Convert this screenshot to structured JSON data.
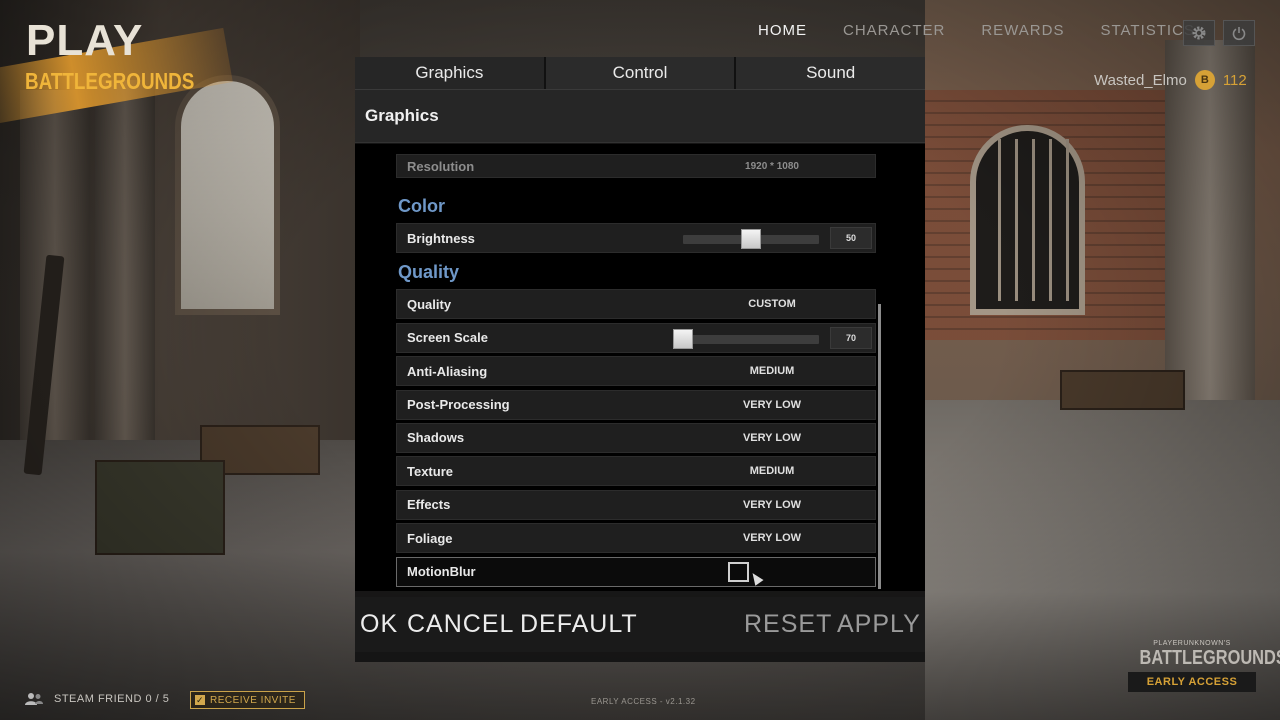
{
  "logo": {
    "play": "PLAY",
    "battlegrounds": "BATTLEGROUNDS"
  },
  "nav": {
    "items": [
      "HOME",
      "CHARACTER",
      "REWARDS",
      "STATISTICS"
    ],
    "active": "HOME"
  },
  "top_icons": {
    "settings": "gear-icon",
    "power": "power-icon"
  },
  "user": {
    "name": "Wasted_Elmo",
    "bp_symbol": "B",
    "bp_value": "112"
  },
  "settings": {
    "tabs": [
      {
        "label": "Graphics"
      },
      {
        "label": "Control"
      },
      {
        "label": "Sound"
      }
    ],
    "active_tab": "Graphics",
    "section_title": "Graphics",
    "resolution": {
      "label": "Resolution",
      "value": "1920 * 1080"
    },
    "color_group": "Color",
    "brightness": {
      "label": "Brightness",
      "value": "50",
      "level": 0.5
    },
    "quality_group": "Quality",
    "quality": {
      "label": "Quality",
      "value": "CUSTOM"
    },
    "screen_scale": {
      "label": "Screen Scale",
      "value": "70",
      "level": 0.0
    },
    "options": [
      {
        "label": "Anti-Aliasing",
        "value": "MEDIUM"
      },
      {
        "label": "Post-Processing",
        "value": "VERY LOW"
      },
      {
        "label": "Shadows",
        "value": "VERY LOW"
      },
      {
        "label": "Texture",
        "value": "MEDIUM"
      },
      {
        "label": "Effects",
        "value": "VERY LOW"
      },
      {
        "label": "Foliage",
        "value": "VERY LOW"
      }
    ],
    "motion_blur": {
      "label": "MotionBlur",
      "checked": false
    },
    "actions_left": {
      "ok": "OK",
      "cancel": "CANCEL",
      "default": "DEFAULT"
    },
    "actions_right": {
      "reset": "RESET",
      "apply": "APPLY"
    }
  },
  "bottom": {
    "friends": "STEAM FRIEND 0 / 5",
    "invite": "RECEIVE INVITE",
    "version": "EARLY ACCESS - v2.1.32",
    "brand_small": "PLAYERUNKNOWN'S",
    "brand_big": "BATTLEGROUNDS",
    "brand_ea": "EARLY ACCESS"
  },
  "colors": {
    "accent_gold": "#d6a136",
    "group_blue": "#6f98c8"
  }
}
